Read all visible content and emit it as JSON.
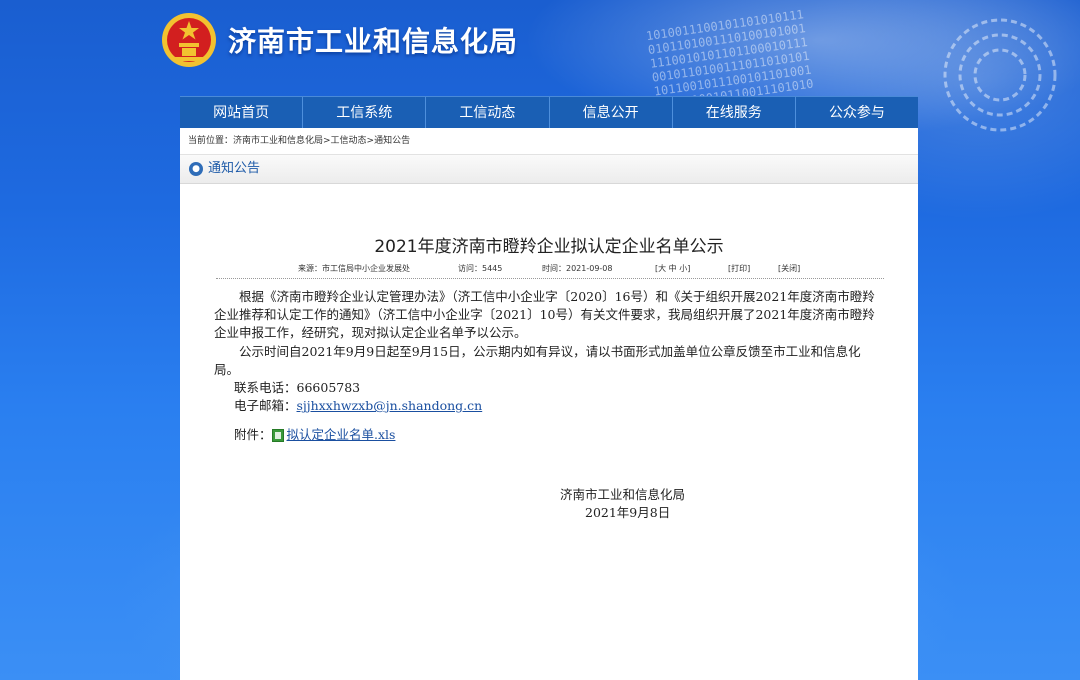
{
  "header": {
    "site_title": "济南市工业和信息化局"
  },
  "nav": [
    {
      "label": "网站首页"
    },
    {
      "label": "工信系统"
    },
    {
      "label": "工信动态"
    },
    {
      "label": "信息公开"
    },
    {
      "label": "在线服务"
    },
    {
      "label": "公众参与"
    }
  ],
  "breadcrumb": "当前位置：济南市工业和信息化局>工信动态>通知公告",
  "section": {
    "label": "通知公告",
    "icon": "notice-icon"
  },
  "article": {
    "title": "2021年度济南市瞪羚企业拟认定企业名单公示",
    "source": "来源：市工信局中小企业发展处",
    "views": "访问：5445",
    "time": "时间：2021-09-08",
    "font_sizes": "[大  中  小]",
    "print": "[打印]",
    "close": "[关闭]",
    "para1": "根据《济南市瞪羚企业认定管理办法》（济工信中小企业字〔2020〕16号）和《关于组织开展2021年度济南市瞪羚企业推荐和认定工作的通知》（济工信中小企业字〔2021〕10号）有关文件要求，我局组织开展了2021年度济南市瞪羚企业申报工作，经研究，现对拟认定企业名单予以公示。",
    "para2": "公示时间自2021年9月9日起至9月15日，公示期内如有异议，请以书面形式加盖单位公章反馈至市工业和信息化局。",
    "phone_label": "联系电话：",
    "phone": "66605783",
    "email_label": "电子邮箱：",
    "email": "sjjhxxhwzxb@jn.shandong.cn",
    "attachment_label": "附件：",
    "attachment": "拟认定企业名单.xls",
    "signature": "济南市工业和信息化局",
    "date": "2021年9月8日"
  },
  "colors": {
    "nav_bg": "#1a5fb4",
    "link": "#1a4fa0",
    "section_label": "#1d5aa8"
  }
}
